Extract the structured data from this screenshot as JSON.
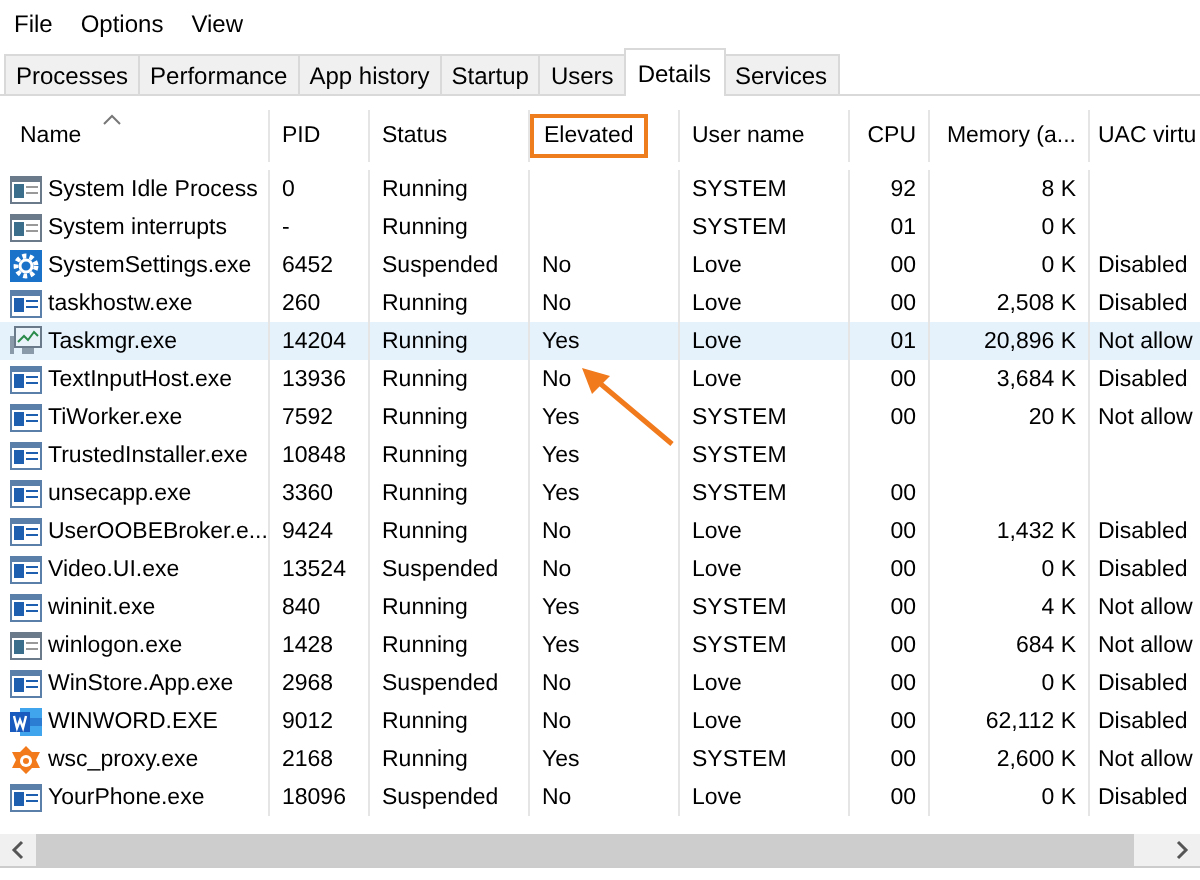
{
  "menu": [
    "File",
    "Options",
    "View"
  ],
  "tabs": [
    {
      "label": "Processes",
      "selected": false
    },
    {
      "label": "Performance",
      "selected": false
    },
    {
      "label": "App history",
      "selected": false
    },
    {
      "label": "Startup",
      "selected": false
    },
    {
      "label": "Users",
      "selected": false
    },
    {
      "label": "Details",
      "selected": true
    },
    {
      "label": "Services",
      "selected": false
    }
  ],
  "table": {
    "columns": [
      {
        "label": "Name",
        "sorted": true,
        "highlighted": false
      },
      {
        "label": "PID",
        "sorted": false,
        "highlighted": false
      },
      {
        "label": "Status",
        "sorted": false,
        "highlighted": false
      },
      {
        "label": "Elevated",
        "sorted": false,
        "highlighted": true
      },
      {
        "label": "User name",
        "sorted": false,
        "highlighted": false
      },
      {
        "label": "CPU",
        "sorted": false,
        "highlighted": false
      },
      {
        "label": "Memory (a...",
        "sorted": false,
        "highlighted": false
      },
      {
        "label": "UAC virtu",
        "sorted": false,
        "highlighted": false
      }
    ],
    "rows": [
      {
        "kind": "window",
        "selected": false,
        "cells": [
          "System Idle Process",
          "0",
          "Running",
          "",
          "SYSTEM",
          "92",
          "8 K",
          ""
        ]
      },
      {
        "kind": "window",
        "selected": false,
        "cells": [
          "System interrupts",
          "-",
          "Running",
          "",
          "SYSTEM",
          "01",
          "0 K",
          ""
        ]
      },
      {
        "kind": "gear",
        "selected": false,
        "cells": [
          "SystemSettings.exe",
          "6452",
          "Suspended",
          "No",
          "Love",
          "00",
          "0 K",
          "Disabled"
        ]
      },
      {
        "kind": "app",
        "selected": false,
        "cells": [
          "taskhostw.exe",
          "260",
          "Running",
          "No",
          "Love",
          "00",
          "2,508 K",
          "Disabled"
        ]
      },
      {
        "kind": "monitor",
        "selected": true,
        "cells": [
          "Taskmgr.exe",
          "14204",
          "Running",
          "Yes",
          "Love",
          "01",
          "20,896 K",
          "Not allow"
        ]
      },
      {
        "kind": "app",
        "selected": false,
        "cells": [
          "TextInputHost.exe",
          "13936",
          "Running",
          "No",
          "Love",
          "00",
          "3,684 K",
          "Disabled"
        ]
      },
      {
        "kind": "app",
        "selected": false,
        "cells": [
          "TiWorker.exe",
          "7592",
          "Running",
          "Yes",
          "SYSTEM",
          "00",
          "20 K",
          "Not allow"
        ]
      },
      {
        "kind": "app",
        "selected": false,
        "cells": [
          "TrustedInstaller.exe",
          "10848",
          "Running",
          "Yes",
          "SYSTEM",
          "",
          "",
          ""
        ]
      },
      {
        "kind": "app",
        "selected": false,
        "cells": [
          "unsecapp.exe",
          "3360",
          "Running",
          "Yes",
          "SYSTEM",
          "00",
          "",
          ""
        ]
      },
      {
        "kind": "app",
        "selected": false,
        "cells": [
          "UserOOBEBroker.e...",
          "9424",
          "Running",
          "No",
          "Love",
          "00",
          "1,432 K",
          "Disabled"
        ]
      },
      {
        "kind": "app",
        "selected": false,
        "cells": [
          "Video.UI.exe",
          "13524",
          "Suspended",
          "No",
          "Love",
          "00",
          "0 K",
          "Disabled"
        ]
      },
      {
        "kind": "app",
        "selected": false,
        "cells": [
          "wininit.exe",
          "840",
          "Running",
          "Yes",
          "SYSTEM",
          "00",
          "4 K",
          "Not allow"
        ]
      },
      {
        "kind": "window",
        "selected": false,
        "cells": [
          "winlogon.exe",
          "1428",
          "Running",
          "Yes",
          "SYSTEM",
          "00",
          "684 K",
          "Not allow"
        ]
      },
      {
        "kind": "app",
        "selected": false,
        "cells": [
          "WinStore.App.exe",
          "2968",
          "Suspended",
          "No",
          "Love",
          "00",
          "0 K",
          "Disabled"
        ]
      },
      {
        "kind": "word",
        "selected": false,
        "cells": [
          "WINWORD.EXE",
          "9012",
          "Running",
          "No",
          "Love",
          "00",
          "62,112 K",
          "Disabled"
        ]
      },
      {
        "kind": "shield",
        "selected": false,
        "cells": [
          "wsc_proxy.exe",
          "2168",
          "Running",
          "Yes",
          "SYSTEM",
          "00",
          "2,600 K",
          "Not allow"
        ]
      },
      {
        "kind": "app",
        "selected": false,
        "cells": [
          "YourPhone.exe",
          "18096",
          "Suspended",
          "No",
          "Love",
          "00",
          "0 K",
          "Disabled"
        ]
      }
    ]
  },
  "annotations": [
    {
      "kind": "arrow"
    }
  ]
}
